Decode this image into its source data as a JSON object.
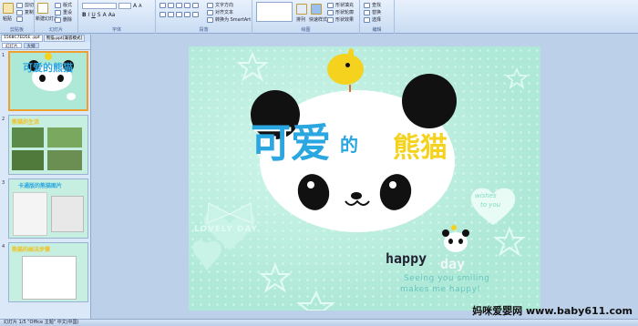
{
  "ribbon": {
    "paste": "粘贴",
    "cut": "剪切",
    "copy": "复制",
    "format_painter": "格式刷",
    "new_slide": "新建幻灯片",
    "layout": "版式",
    "reset": "重设",
    "delete": "删除",
    "group_clipboard": "剪贴板",
    "group_slides": "幻灯片",
    "group_font": "字体",
    "group_paragraph": "段落",
    "group_drawing": "绘图",
    "group_editing": "编辑",
    "text_direction": "文字方向",
    "align_text": "对齐文本",
    "convert_smartart": "转换为 SmartArt",
    "arrange": "排列",
    "quick_styles": "快速样式",
    "shape_fill": "形状填充",
    "shape_outline": "形状轮廓",
    "shape_effects": "形状效果",
    "find": "查找",
    "replace": "替换",
    "select": "选择"
  },
  "doc_tabs": [
    "1568C7ED5E .ppt",
    "熊猫.ppt[兼容模式]"
  ],
  "panel_tabs": [
    "幻灯片",
    "大纲"
  ],
  "thumbs": [
    {
      "num": "1",
      "title": "可爱的熊猫"
    },
    {
      "num": "2",
      "title": "熊猫的生活"
    },
    {
      "num": "3",
      "title": "卡通版的熊猫图片"
    },
    {
      "num": "4",
      "title": "熊猫的画法步骤"
    }
  ],
  "slide": {
    "title_part1": "可爱",
    "title_part2": "的",
    "title_part3": "熊猫",
    "lovely_day": "LOVELY DAY",
    "wishes": "wishes",
    "to_you": "to you",
    "happy": "happy",
    "day": "day",
    "line1": "Seeing you smiling",
    "line2": "makes me happy!"
  },
  "status_text": "幻灯片 1/5    \"Office 主题\"    中文(中国)",
  "watermark": "妈咪爱婴网 www.baby611.com",
  "colors": {
    "slide_bg": "#aee8d7",
    "title_blue": "#2aa7e0",
    "title_yellow": "#f4d21d",
    "ribbon_bg": "#dbe8f7"
  }
}
